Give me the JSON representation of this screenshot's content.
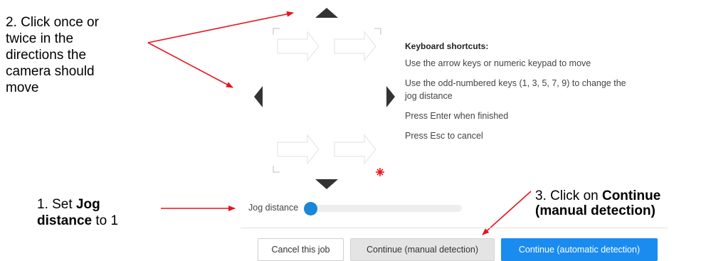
{
  "annotations": {
    "step2": [
      "2. Click once or",
      "twice in the",
      "directions the",
      "camera should",
      "move"
    ],
    "step3_prefix": "3. Click on ",
    "step3_bold_line1": "Continue",
    "step3_bold_line2": "(manual detection)",
    "step1_prefix": "1. Set ",
    "step1_bold1": "Jog",
    "step1_bold2": "distance",
    "step1_suffix": " to 1"
  },
  "shortcuts": {
    "title": "Keyboard shortcuts:",
    "line1": "Use the arrow keys or numeric keypad to move",
    "line2a": "Use the odd-numbered keys (1, 3, 5, 7, 9) to change the",
    "line2b": "jog distance",
    "line3": "Press Enter when finished",
    "line4": "Press Esc to cancel"
  },
  "jog": {
    "label": "Jog distance",
    "value": 1
  },
  "buttons": {
    "cancel": "Cancel this job",
    "manual": "Continue (manual detection)",
    "auto": "Continue (automatic detection)"
  },
  "colors": {
    "arrow_annotation": "#e8141c",
    "primary": "#1a8cf0",
    "slider_thumb": "#1a86d8"
  }
}
